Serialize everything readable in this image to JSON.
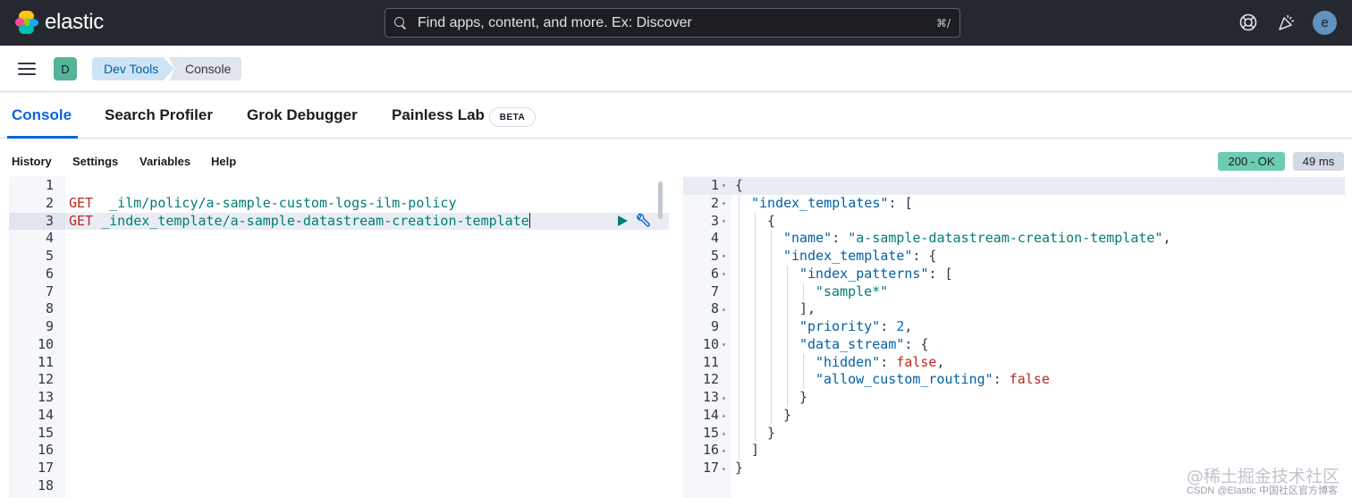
{
  "header": {
    "brand": "elastic",
    "search_placeholder": "Find apps, content, and more. Ex: Discover",
    "search_shortcut": "⌘/",
    "avatar_initial": "e",
    "colors": {
      "bar": "#25282f",
      "avatar": "#6092c0"
    }
  },
  "breadcrumbs": {
    "space_initial": "D",
    "items": [
      "Dev Tools",
      "Console"
    ],
    "colors": {
      "space": "#54b399",
      "active_crumb": "#cce4f5"
    }
  },
  "tabs": {
    "items": [
      "Console",
      "Search Profiler",
      "Grok Debugger",
      "Painless Lab"
    ],
    "selected": "Console",
    "painless_badge": "BETA",
    "accent": "#0b64dd"
  },
  "toolbar": {
    "items": [
      "History",
      "Settings",
      "Variables",
      "Help"
    ],
    "status": "200 - OK",
    "duration": "49 ms",
    "status_color": "#6dccb1"
  },
  "request_editor": {
    "line_numbers": [
      "1",
      "2",
      "3",
      "4",
      "5",
      "6",
      "7",
      "8",
      "9",
      "10",
      "11",
      "12",
      "13",
      "14",
      "15",
      "16",
      "17",
      "18"
    ],
    "requests": [
      {
        "line": "2",
        "method": "GET",
        "path": "  _ilm/policy/a-sample-custom-logs-ilm-policy"
      },
      {
        "line": "3",
        "method": "GET",
        "path": " _index_template/a-sample-datastream-creation-template"
      }
    ],
    "active_line": "3"
  },
  "response_editor": {
    "line_numbers": [
      "1",
      "2",
      "3",
      "4",
      "5",
      "6",
      "7",
      "8",
      "9",
      "10",
      "11",
      "12",
      "13",
      "14",
      "15",
      "16",
      "17"
    ],
    "lines": [
      {
        "parts": [
          [
            "p",
            "{"
          ]
        ],
        "indent": 0,
        "fold": "open"
      },
      {
        "parts": [
          [
            "k",
            "\"index_templates\""
          ],
          [
            "p",
            ": ["
          ]
        ],
        "indent": 1,
        "fold": "open"
      },
      {
        "parts": [
          [
            "p",
            "{"
          ]
        ],
        "indent": 2,
        "fold": "open"
      },
      {
        "parts": [
          [
            "k",
            "\"name\""
          ],
          [
            "p",
            ": "
          ],
          [
            "s",
            "\"a-sample-datastream-creation-template\""
          ],
          [
            "p",
            ","
          ]
        ],
        "indent": 3,
        "fold": ""
      },
      {
        "parts": [
          [
            "k",
            "\"index_template\""
          ],
          [
            "p",
            ": {"
          ]
        ],
        "indent": 3,
        "fold": "open"
      },
      {
        "parts": [
          [
            "k",
            "\"index_patterns\""
          ],
          [
            "p",
            ": ["
          ]
        ],
        "indent": 4,
        "fold": "open"
      },
      {
        "parts": [
          [
            "s",
            "\"sample*\""
          ]
        ],
        "indent": 5,
        "fold": ""
      },
      {
        "parts": [
          [
            "p",
            "],"
          ]
        ],
        "indent": 4,
        "fold": "close"
      },
      {
        "parts": [
          [
            "k",
            "\"priority\""
          ],
          [
            "p",
            ": "
          ],
          [
            "n",
            "2"
          ],
          [
            "p",
            ","
          ]
        ],
        "indent": 4,
        "fold": ""
      },
      {
        "parts": [
          [
            "k",
            "\"data_stream\""
          ],
          [
            "p",
            ": {"
          ]
        ],
        "indent": 4,
        "fold": "open"
      },
      {
        "parts": [
          [
            "k",
            "\"hidden\""
          ],
          [
            "p",
            ": "
          ],
          [
            "b",
            "false"
          ],
          [
            "p",
            ","
          ]
        ],
        "indent": 5,
        "fold": ""
      },
      {
        "parts": [
          [
            "k",
            "\"allow_custom_routing\""
          ],
          [
            "p",
            ": "
          ],
          [
            "b",
            "false"
          ]
        ],
        "indent": 5,
        "fold": ""
      },
      {
        "parts": [
          [
            "p",
            "}"
          ]
        ],
        "indent": 4,
        "fold": "close"
      },
      {
        "parts": [
          [
            "p",
            "}"
          ]
        ],
        "indent": 3,
        "fold": "close"
      },
      {
        "parts": [
          [
            "p",
            "}"
          ]
        ],
        "indent": 2,
        "fold": "close"
      },
      {
        "parts": [
          [
            "p",
            "]"
          ]
        ],
        "indent": 1,
        "fold": "close"
      },
      {
        "parts": [
          [
            "p",
            "}"
          ]
        ],
        "indent": 0,
        "fold": "close"
      }
    ]
  },
  "watermark": {
    "main": "@稀土掘金技术社区",
    "sub": "CSDN @Elastic 中国社区官方博客"
  }
}
